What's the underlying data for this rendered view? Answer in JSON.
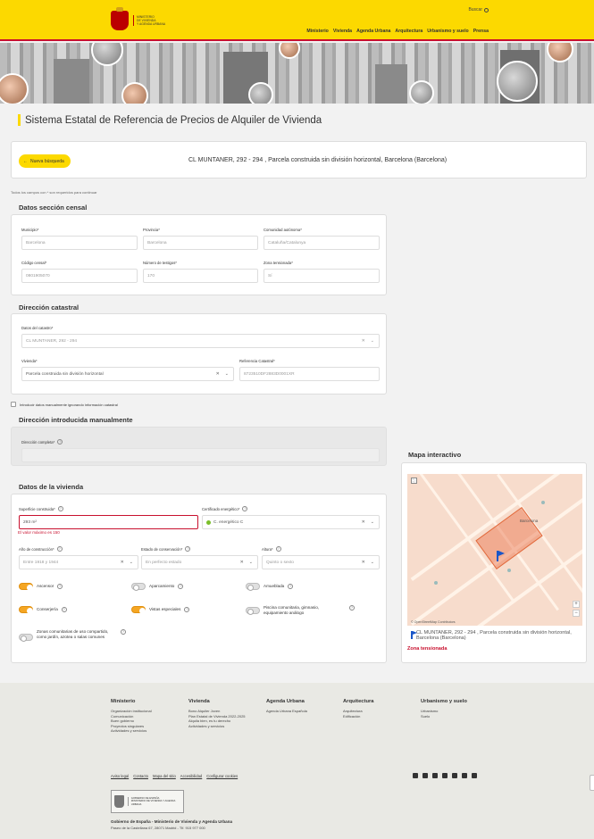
{
  "header": {
    "logo_text": [
      "Ministerio",
      "de Vivienda",
      "y Agenda Urbana"
    ],
    "search_label": "Buscar",
    "nav": [
      "Ministerio",
      "Vivienda",
      "Agenda Urbana",
      "Arquitectura",
      "Urbanismo y suelo",
      "Prensa"
    ]
  },
  "page_title": "Sistema Estatal de Referencia de Precios de Alquiler de Vivienda",
  "address_bar": {
    "back_button": "Nueva búsqueda",
    "address": "CL MUNTANER, 292 - 294 , Parcela construida sin división horizontal, Barcelona (Barcelona)"
  },
  "required_note": "Todos los campos con * son requeridos para continuar",
  "censal": {
    "title": "Datos sección censal",
    "municipio": {
      "label": "Municipio*",
      "value": "Barcelona"
    },
    "provincia": {
      "label": "Provincia*",
      "value": "Barcelona"
    },
    "comunidad": {
      "label": "Comunidad autónoma*",
      "value": "Cataluña/Catalunya"
    },
    "codigo": {
      "label": "Código censal*",
      "value": "0801905070"
    },
    "testigos": {
      "label": "Número de testigos*",
      "value": "170"
    },
    "zona": {
      "label": "Zona tensionada*",
      "value": "Sí"
    }
  },
  "catastral": {
    "title": "Dirección catastral",
    "datos": {
      "label": "Datos del catastro*",
      "value": "CL MUNTANER, 292 - 294"
    },
    "vivienda": {
      "label": "Vivienda*",
      "value": "Parcela construida sin división horizontal"
    },
    "referencia": {
      "label": "Referencia Catastral*",
      "value": "8723510DF2883D0001XR"
    }
  },
  "manual_checkbox": "Introducir datos manualmente ignorando información catastral",
  "manual": {
    "title": "Dirección introducida manualmente",
    "direccion": {
      "label": "Dirección completa*",
      "value": ""
    }
  },
  "vivienda": {
    "title": "Datos de la vivienda",
    "superficie": {
      "label": "Superficie construida*",
      "value": "293  m²"
    },
    "superficie_error": "El valor máximo es 150",
    "certificado": {
      "label": "Certificado energético*",
      "value": "C. energético C"
    },
    "anio": {
      "label": "Año de construcción*",
      "value": "Entre 1918 y 1944"
    },
    "estado": {
      "label": "Estado de conservación*",
      "value": "En perfecto estado"
    },
    "altura": {
      "label": "Altura*",
      "value": "Quinto o sexto"
    },
    "toggles": {
      "ascensor": {
        "label": "Ascensor",
        "on": true
      },
      "aparcamiento": {
        "label": "Aparcamiento",
        "on": false
      },
      "amueblada": {
        "label": "Amueblada",
        "on": false
      },
      "conserjeria": {
        "label": "Conserjería",
        "on": true
      },
      "vistas": {
        "label": "Vistas especiales",
        "on": true
      },
      "piscina": {
        "label": "Piscina comunitaria, gimnasio, equipamiento análogo",
        "on": false
      },
      "zonas": {
        "label": "Zonas comunitarias de uso compartido, como jardín, azotea o salas comunes",
        "on": false
      }
    }
  },
  "map": {
    "title": "Mapa interactivo",
    "street_label": "Barcelona",
    "attribution": "© OpenStreetMap Contributors",
    "zoom_in": "+",
    "zoom_out": "−",
    "address": "CL MUNTANER, 292 - 294 , Parcela construida sin división horizontal, Barcelona (Barcelona)",
    "zona": "Zona tensionada"
  },
  "footer": {
    "columns": [
      {
        "title": "Ministerio",
        "items": [
          "Organización institucional",
          "Comunicación",
          "Buen gobierno",
          "Proyectos singulares",
          "Actividades y servicios"
        ]
      },
      {
        "title": "Vivienda",
        "items": [
          "Bono Alquiler Joven",
          "Plan Estatal de Vivienda 2022-2025",
          "Alquila bien, es tu derecho",
          "Actividades y servicios"
        ]
      },
      {
        "title": "Agenda Urbana",
        "items": [
          "Agenda Urbana Española"
        ]
      },
      {
        "title": "Arquitectura",
        "items": [
          "Arquitectura",
          "Edificación"
        ]
      },
      {
        "title": "Urbanismo y suelo",
        "items": [
          "Urbanismo",
          "Suelo"
        ]
      }
    ],
    "legal": [
      "Aviso legal",
      "Contacto",
      "Mapa del sitio",
      "Accesibilidad",
      "Configurar cookies"
    ],
    "social_icons": [
      "twitter-icon",
      "youtube-icon",
      "facebook-icon",
      "instagram-icon",
      "telegram-icon",
      "linkedin-icon",
      "podcast-icon"
    ],
    "gov_logo": [
      "Gobierno de España",
      "Ministerio de Vivienda y Agenda Urbana"
    ],
    "gov_name": "Gobierno de España - Ministerio de Vivienda y Agenda Urbana",
    "gov_address": "Paseo de la Castellana 67, 28071 Madrid - Tlf. 915 977 000"
  }
}
